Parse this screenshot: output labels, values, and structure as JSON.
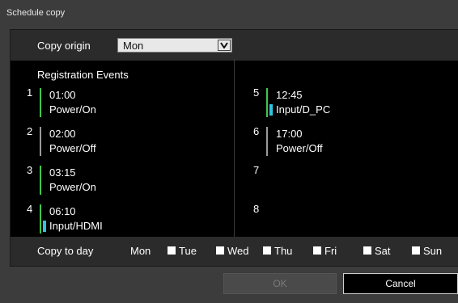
{
  "window": {
    "title": "Schedule copy"
  },
  "origin": {
    "label": "Copy origin",
    "selected": "Mon"
  },
  "events": {
    "title": "Registration Events",
    "items": [
      {
        "num": "1",
        "time": "01:00",
        "action": "Power/On",
        "bar": "#3ec84a",
        "tag": false
      },
      {
        "num": "2",
        "time": "02:00",
        "action": "Power/Off",
        "bar": "#9a9a9a",
        "tag": false
      },
      {
        "num": "3",
        "time": "03:15",
        "action": "Power/On",
        "bar": "#3ec84a",
        "tag": false
      },
      {
        "num": "4",
        "time": "06:10",
        "action": "Input/HDMI",
        "bar": "#3ec84a",
        "tag": true
      },
      {
        "num": "5",
        "time": "12:45",
        "action": "Input/D_PC",
        "bar": "#3ec84a",
        "tag": true
      },
      {
        "num": "6",
        "time": "17:00",
        "action": "Power/Off",
        "bar": "#9a9a9a",
        "tag": false
      },
      {
        "num": "7",
        "time": "",
        "action": "",
        "bar": "",
        "tag": false
      },
      {
        "num": "8",
        "time": "",
        "action": "",
        "bar": "",
        "tag": false
      }
    ]
  },
  "copy": {
    "label": "Copy to day",
    "days": [
      {
        "label": "Mon",
        "checkbox": false
      },
      {
        "label": "Tue",
        "checkbox": true
      },
      {
        "label": "Wed",
        "checkbox": true
      },
      {
        "label": "Thu",
        "checkbox": true
      },
      {
        "label": "Fri",
        "checkbox": true
      },
      {
        "label": "Sat",
        "checkbox": true
      },
      {
        "label": "Sun",
        "checkbox": true
      }
    ]
  },
  "buttons": {
    "ok": "OK",
    "cancel": "Cancel"
  },
  "colors": {
    "on_bar": "#3ec84a",
    "off_bar": "#9a9a9a",
    "input_tag": "#2ec4e0"
  }
}
